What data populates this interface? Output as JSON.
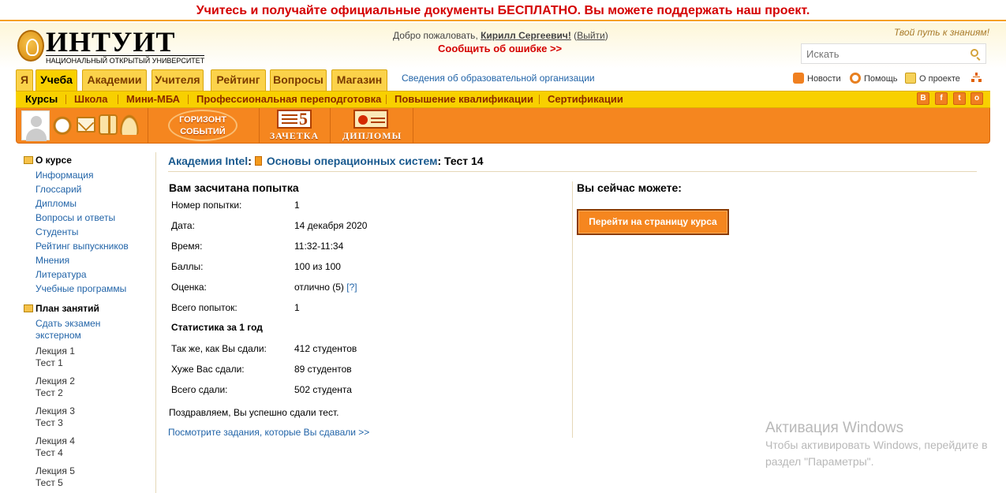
{
  "banner": "Учитесь и получайте официальные документы БЕСПЛАТНО. Вы можете поддержать наш проект.",
  "header": {
    "logo_name": "ИНТУИТ",
    "logo_sub": "НАЦИОНАЛЬНЫЙ ОТКРЫТЫЙ УНИВЕРСИТЕТ",
    "welcome_prefix": "Добро пожаловать, ",
    "user_name": "Кирилл Сергеевич!",
    "logout_open": " (",
    "logout": "Выйти",
    "logout_close": ")",
    "report_error": "Сообщить об ошибке >>",
    "slogan": "Твой путь к знаниям!",
    "search_placeholder": "Искать"
  },
  "tabs": [
    {
      "label": "Я"
    },
    {
      "label": "Учеба"
    },
    {
      "label": "Академии"
    },
    {
      "label": "Учителя"
    },
    {
      "label": "Рейтинг"
    },
    {
      "label": "Вопросы"
    },
    {
      "label": "Магазин"
    }
  ],
  "edu_info_link": "Сведения об образовательной организации",
  "top_links": {
    "news": "Новости",
    "help": "Помощь",
    "about": "О проекте"
  },
  "subnav": [
    {
      "label": "Курсы"
    },
    {
      "label": "Школа"
    },
    {
      "label": "Мини-МБА"
    },
    {
      "label": "Профессиональная переподготовка"
    },
    {
      "label": "Повышение квалификации"
    },
    {
      "label": "Сертификации"
    }
  ],
  "social": [
    "В",
    "f",
    "t",
    "о"
  ],
  "toolbar": {
    "horizon_line1": "ГОРИЗОНТ",
    "horizon_line2": "СОБЫТИЙ",
    "zachetka": "ЗАЧЕТКА",
    "diplomas": "ДИПЛОМЫ"
  },
  "sidebar": {
    "about_head": "О курсе",
    "about_items": [
      "Информация",
      "Глоссарий",
      "Дипломы",
      "Вопросы и ответы",
      "Студенты",
      "Рейтинг выпускников",
      "Мнения",
      "Литература",
      "Учебные программы"
    ],
    "plan_head": "План занятий",
    "exam_line1": "Сдать экзамен",
    "exam_line2": "экстерном",
    "lectures": [
      {
        "lecture": "Лекция 1",
        "test": "Тест 1"
      },
      {
        "lecture": "Лекция 2",
        "test": "Тест 2"
      },
      {
        "lecture": "Лекция 3",
        "test": "Тест 3"
      },
      {
        "lecture": "Лекция 4",
        "test": "Тест 4"
      },
      {
        "lecture": "Лекция 5",
        "test": "Тест 5"
      }
    ]
  },
  "breadcrumb": {
    "academy": "Академия Intel",
    "colon1": ":",
    "course": "Основы операционных систем",
    "test": ": Тест 14"
  },
  "result": {
    "title": "Вам засчитана попытка",
    "rows": [
      {
        "label": "Номер попытки:",
        "value": "1"
      },
      {
        "label": "Дата:",
        "value": "14 декабря 2020"
      },
      {
        "label": "Время:",
        "value": "11:32-11:34"
      },
      {
        "label": "Баллы:",
        "value": "100 из 100"
      },
      {
        "label": "Оценка:",
        "value": "отлично (5)",
        "link": "[?]"
      },
      {
        "label": "Всего попыток:",
        "value": "1"
      }
    ],
    "stats_title": "Статистика за 1 год",
    "stats": [
      {
        "label": "Так же, как Вы сдали:",
        "value": "412 студентов"
      },
      {
        "label": "Хуже Вас сдали:",
        "value": "89 студентов"
      },
      {
        "label": "Всего сдали:",
        "value": "502 студента"
      }
    ],
    "congrats": "Поздравляем, Вы успешно сдали тест.",
    "tasks_link": "Посмотрите задания, которые Вы сдавали >>"
  },
  "actions": {
    "title": "Вы сейчас можете:",
    "go_course": "Перейти на страницу курса"
  },
  "watermark": {
    "title": "Активация Windows",
    "text": "Чтобы активировать Windows, перейдите в раздел \"Параметры\"."
  },
  "colors": {
    "accent_orange": "#f5861f",
    "tab_yellow": "#f8d000",
    "link_blue": "#2264a8",
    "alert_red": "#d40000"
  }
}
